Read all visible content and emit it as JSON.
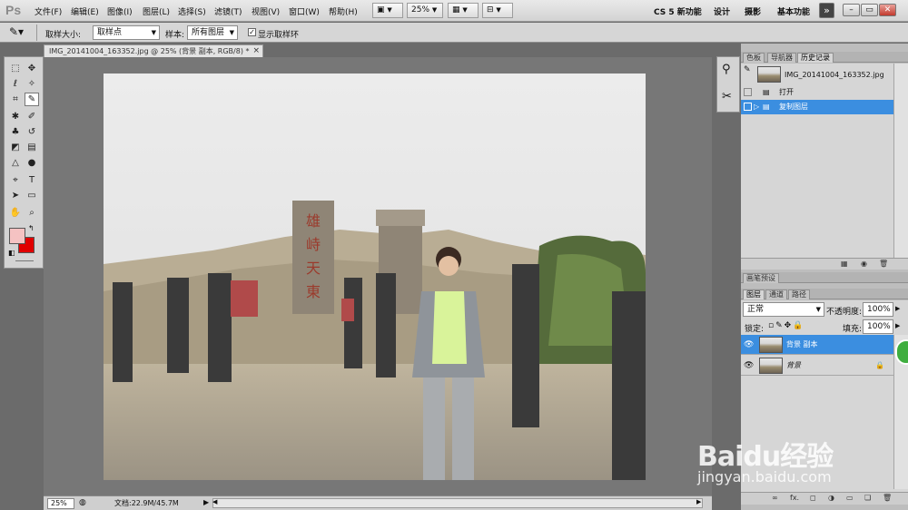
{
  "app": {
    "logo": "Ps"
  },
  "menu": [
    "文件(F)",
    "编辑(E)",
    "图像(I)",
    "图层(L)",
    "选择(S)",
    "滤镜(T)",
    "视图(V)",
    "窗口(W)",
    "帮助(H)"
  ],
  "menubar_controls": {
    "zoom": "25%",
    "caret": "▼"
  },
  "workspaces": [
    "CS 5 新功能",
    "设计",
    "摄影",
    "基本功能"
  ],
  "window_controls": {
    "overflow": "»",
    "minimize": "–",
    "restore": "▭",
    "close": "✕"
  },
  "options": {
    "sample_size_label": "取样大小:",
    "sample_size_value": "取样点",
    "sample_label": "样本:",
    "sample_value": "所有图层",
    "show_ring_label": "显示取样环",
    "show_ring_checked": true
  },
  "document": {
    "tab_title": "IMG_20141004_163352.jpg @ 25% (背景 副本, RGB/8) *",
    "tab_close": "×",
    "zoom": "25%",
    "doc_info": "文档:22.9M/45.7M"
  },
  "history_panel": {
    "tabs": [
      "色板",
      "导航器",
      "历史记录"
    ],
    "active_tab": "历史记录",
    "snapshot": "IMG_20141004_163352.jpg",
    "items": [
      {
        "label": "打开",
        "selected": false
      },
      {
        "label": "复制图层",
        "selected": true
      }
    ]
  },
  "brush_presets_tab": "画笔预设",
  "layers_panel": {
    "tabs": [
      "图层",
      "通道",
      "路径"
    ],
    "active_tab": "图层",
    "blend_mode": "正常",
    "opacity_label": "不透明度:",
    "opacity_value": "100%",
    "lock_label": "锁定:",
    "fill_label": "填充:",
    "fill_value": "100%",
    "layers": [
      {
        "name": "背景 副本",
        "selected": true,
        "locked": false
      },
      {
        "name": "背景",
        "selected": false,
        "locked": true
      }
    ],
    "bottom_icons": [
      "∞",
      "fx.",
      "◻",
      "◑",
      "▭",
      "❏",
      "🗑"
    ]
  },
  "watermark": {
    "brand": "Baidu经验",
    "url": "jingyan.baidu.com"
  },
  "colors": {
    "foreground": "#f5c2c2",
    "background": "#e00000",
    "selection": "#3b8ee0"
  }
}
